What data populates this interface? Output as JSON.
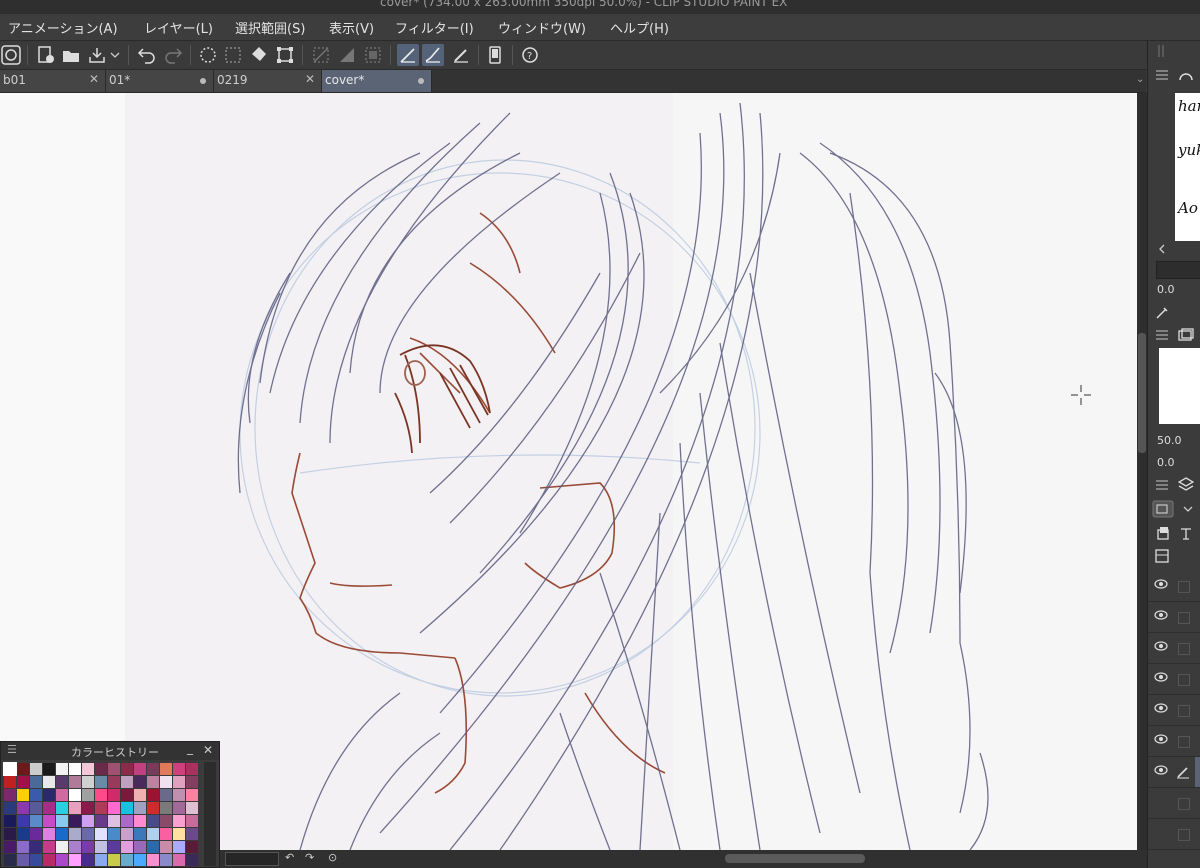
{
  "window": {
    "title": "cover* (734.00 x 263.00mm 350dpi 50.0%)  - CLIP STUDIO PAINT EX"
  },
  "menu": {
    "items": [
      "アニメーション(A)",
      "レイヤー(L)",
      "選択範囲(S)",
      "表示(V)",
      "フィルター(I)",
      "ウィンドウ(W)",
      "ヘルプ(H)"
    ]
  },
  "toolbar": {
    "buttons": [
      "clip-studio-logo-icon",
      "new-file-icon",
      "open-folder-icon",
      "save-icon",
      "undo-icon",
      "redo-icon",
      "clear-selection-icon",
      "select-all-icon",
      "fill-icon",
      "transform-icon",
      "ruler-snap-icon",
      "ruler-special-icon",
      "grid-icon",
      "pen-pressure-icon",
      "brush-pressure-icon",
      "pencil-icon",
      "smartphone-icon",
      "help-icon"
    ]
  },
  "tabs": [
    {
      "label": "b01",
      "marker": "close"
    },
    {
      "label": "01*",
      "marker": "dot"
    },
    {
      "label": "0219",
      "marker": "close"
    },
    {
      "label": "cover*",
      "marker": "dot",
      "active": true
    }
  ],
  "color_history": {
    "title": "カラーヒストリー",
    "swatches": [
      "#ffffff",
      "#6b1a1a",
      "#cccccc",
      "#1a1a1a",
      "#f2f2f2",
      "#ffffff",
      "#f4c7d8",
      "#6a2a4a",
      "#a05070",
      "#8c2a4a",
      "#c04080",
      "#7a3a5a",
      "#e07a5a",
      "#d04080",
      "#aa3060",
      "#c02020",
      "#a0104a",
      "#4a6a9a",
      "#e8e8e8",
      "#5a3a6a",
      "#b07a9a",
      "#d0d0d0",
      "#6a8aaa",
      "#9a3a5a",
      "#c0a0c0",
      "#4a2a5a",
      "#c080a0",
      "#f0e0f0",
      "#e0a0c0",
      "#804060",
      "#7a2a6a",
      "#ffd000",
      "#3a5aaa",
      "#2a2a6a",
      "#d06aa0",
      "#ffffff",
      "#a0a0a0",
      "#ff4a8a",
      "#d02a6a",
      "#7a1a3a",
      "#f0b0b0",
      "#a01030",
      "#6a6a8a",
      "#c090b0",
      "#ff80a0",
      "#2a3a7a",
      "#8a3aaa",
      "#5a5a9a",
      "#aa2a8a",
      "#2ad0e0",
      "#e8a0c0",
      "#8a1a4a",
      "#b03a5a",
      "#ff6ad0",
      "#1ac0e0",
      "#a0a0c0",
      "#d02a2a",
      "#7a7a7a",
      "#a06a9a",
      "#e0c0d0",
      "#1a1a5a",
      "#3a3aaa",
      "#5a8aca",
      "#ca4aca",
      "#8acaf0",
      "#3a1a5a",
      "#d0a0f0",
      "#6a3a8a",
      "#e0c0e0",
      "#aa6aca",
      "#ff8ad0",
      "#4a4a8a",
      "#8a4a6a",
      "#faa0d0",
      "#ca6a9a",
      "#2a1a4a",
      "#1a3a8a",
      "#6a2a9a",
      "#e080e0",
      "#1a6aca",
      "#aaaaca",
      "#6a6aaa",
      "#e0e0ff",
      "#4a8aca",
      "#caa0ca",
      "#3a7aba",
      "#b0d0f0",
      "#fa60a0",
      "#ffe0a0",
      "#6a4a8a",
      "#4a1a6a",
      "#8a6aca",
      "#3a2a7a",
      "#ca3a8a",
      "#f0f0f0",
      "#aa80ca",
      "#7a3aaa",
      "#c0c0e0",
      "#5a3a9a",
      "#e0a0e0",
      "#9a6aba",
      "#2a6aaa",
      "#ca8aaa",
      "#aaaaff",
      "#5a1a3a",
      "#2a2a4a",
      "#6a5aaa",
      "#3a4a9a",
      "#ba2a6a",
      "#aa4aca",
      "#ffa0ff",
      "#4a2a8a",
      "#8aaaf0",
      "#caca4a",
      "#6aaaca",
      "#4aaaff",
      "#fa90d0",
      "#8a8aca",
      "#da6aaa",
      "#3a2a5a"
    ]
  },
  "right_panel": {
    "navigator_preview_lines": [
      "han",
      "yuk",
      "Ao"
    ],
    "values": [
      "0.0",
      "50.0",
      "0.0"
    ]
  }
}
